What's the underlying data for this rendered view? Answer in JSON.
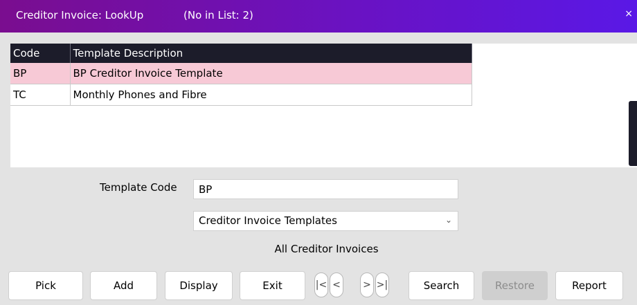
{
  "window": {
    "title": "Creditor Invoice: LookUp",
    "count": "(No in List: 2)",
    "close": "×"
  },
  "table": {
    "headers": [
      "Code",
      "Template Description"
    ],
    "rows": [
      {
        "code": "BP",
        "description": "BP Creditor Invoice Template",
        "selected": true
      },
      {
        "code": "TC",
        "description": "Monthly Phones and Fibre",
        "selected": false
      }
    ]
  },
  "form": {
    "template_code_label": "Template Code",
    "template_code_value": "BP",
    "filter_selected": "Creditor Invoice Templates",
    "info_text": "All Creditor Invoices"
  },
  "buttons": {
    "pick": "Pick",
    "add": "Add",
    "display": "Display",
    "exit": "Exit",
    "first": "|<",
    "prev": "<",
    "next": ">",
    "last": ">|",
    "search": "Search",
    "restore": "Restore",
    "report": "Report"
  },
  "colors": {
    "title_bar_start": "#7a0d8f",
    "title_bar_end": "#5a18e6",
    "header_bg": "#1c1c2a",
    "selected_row": "#f7c9d6"
  }
}
